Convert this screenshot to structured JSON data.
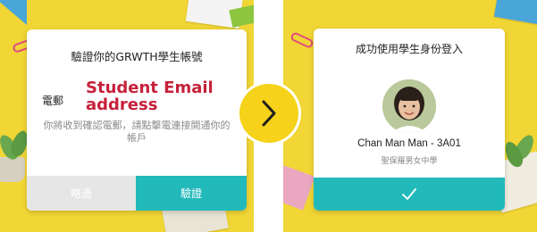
{
  "left_panel": {
    "title": "驗證你的GRWTH學生帳號",
    "email_label": "電郵",
    "email_value": "Student Email address",
    "hint": "你將收到確認電郵，請點擊電連接開通你的帳戶",
    "skip_label": "略過",
    "verify_label": "驗證"
  },
  "next_arrow": {
    "icon": "chevron-right-icon"
  },
  "right_panel": {
    "title": "成功使用學生身份登入",
    "avatar_icon": "student-avatar",
    "user_name": "Chan Man Man - 3A01",
    "school_name": "聖保羅男女中學",
    "confirm_icon": "check-icon"
  },
  "colors": {
    "background_yellow": "#f1d635",
    "teal": "#22b9bb",
    "email_red": "#c6213a",
    "arrow_yellow": "#f6d21a",
    "skip_gray": "#e6e6e6"
  }
}
